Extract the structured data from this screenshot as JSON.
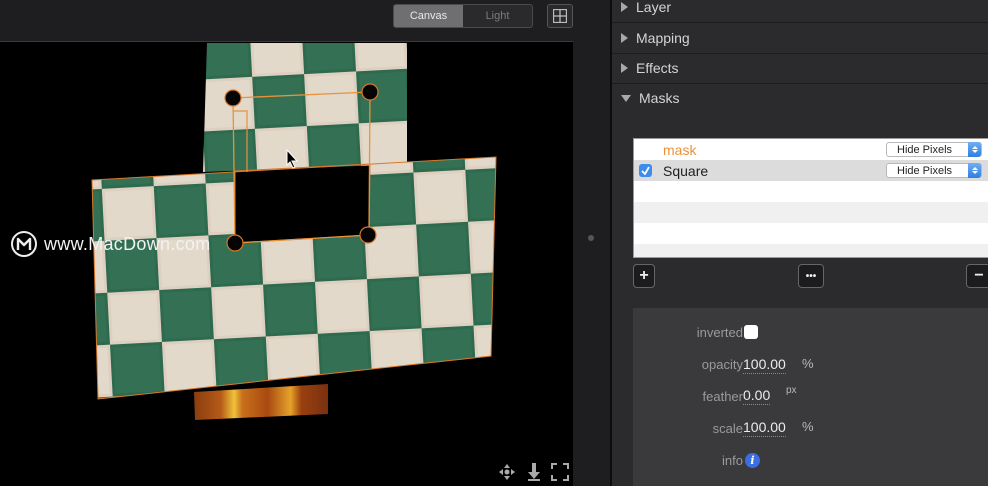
{
  "toolbar": {
    "segments": [
      {
        "label": "Canvas",
        "active": true
      },
      {
        "label": "Light",
        "active": false
      }
    ],
    "grid_icon": "grid-icon"
  },
  "canvas": {
    "watermark": "www.MacDown.com",
    "tools": [
      "move-icon",
      "depth-icon",
      "fullscreen-icon"
    ]
  },
  "inspector": {
    "sections": [
      {
        "label": "Layer",
        "expanded": false
      },
      {
        "label": "Mapping",
        "expanded": false
      },
      {
        "label": "Effects",
        "expanded": false
      },
      {
        "label": "Masks",
        "expanded": true
      }
    ],
    "masks": {
      "rows": [
        {
          "name": "mask",
          "mode": "Hide Pixels",
          "checked": false,
          "color": "#e8923a"
        },
        {
          "name": "Square",
          "mode": "Hide Pixels",
          "checked": true,
          "color": "#1e1e1e"
        }
      ],
      "add_label": "+",
      "more_label": "•••",
      "remove_label": "−"
    },
    "props": {
      "inverted_label": "inverted",
      "opacity_label": "opacity",
      "opacity_value": "100.00",
      "opacity_unit": "%",
      "feather_label": "feather",
      "feather_value": "0.00",
      "feather_unit": "px",
      "scale_label": "scale",
      "scale_value": "100.00",
      "scale_unit": "%",
      "info_label": "info"
    }
  },
  "colors": {
    "accent": "#e8923a",
    "tile_green": "#2f6b4f",
    "tile_cream": "#e3d7c8",
    "selection_blue": "#3b8ced"
  }
}
